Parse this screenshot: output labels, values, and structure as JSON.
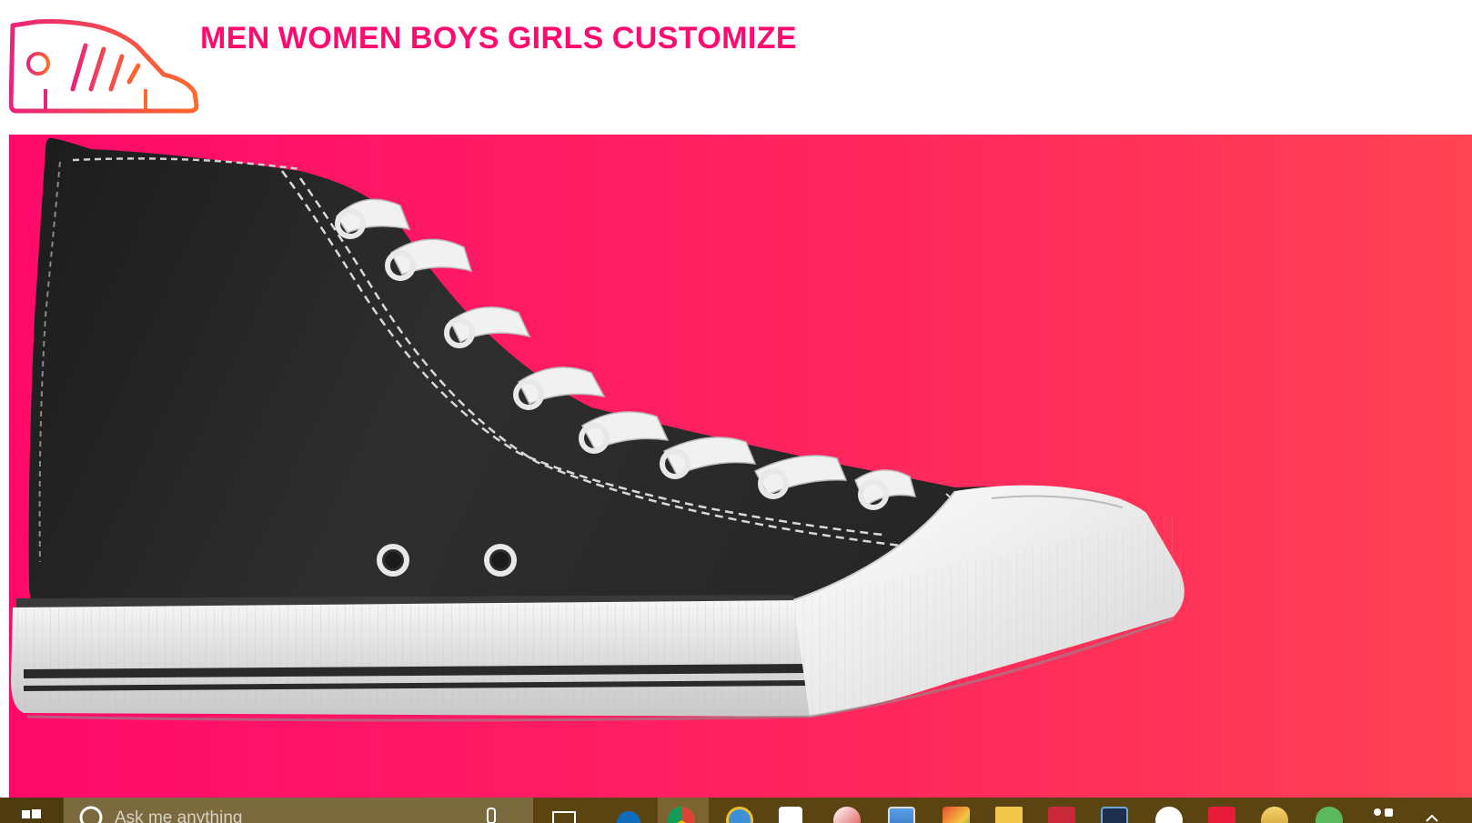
{
  "nav": {
    "items": [
      {
        "label": "MEN"
      },
      {
        "label": "WOMEN"
      },
      {
        "label": "BOYS"
      },
      {
        "label": "GIRLS"
      },
      {
        "label": "CUSTOMIZE"
      }
    ]
  },
  "brand": {
    "logo_icon": "sneaker-icon",
    "accent_color": "#ff0b70",
    "logo_gradient": [
      "#e8247a",
      "#ff6a2a"
    ]
  },
  "hero": {
    "image": "black-high-top-sneaker",
    "gradient": [
      "#ff0a6a",
      "#ff4454"
    ]
  },
  "taskbar": {
    "search_placeholder": "Ask me anything",
    "icons": [
      "windows-start-icon",
      "search-icon",
      "microphone-icon",
      "task-view-icon",
      "edge-icon",
      "chrome-icon",
      "internet-explorer-icon",
      "store-icon",
      "paint-icon",
      "app-icon",
      "photos-icon",
      "file-explorer-icon",
      "acrobat-icon",
      "lightroom-icon",
      "settings-icon",
      "app-red-icon",
      "app-yellow-icon",
      "app-green-icon",
      "app-grid-icon",
      "chevron-up-icon"
    ]
  }
}
